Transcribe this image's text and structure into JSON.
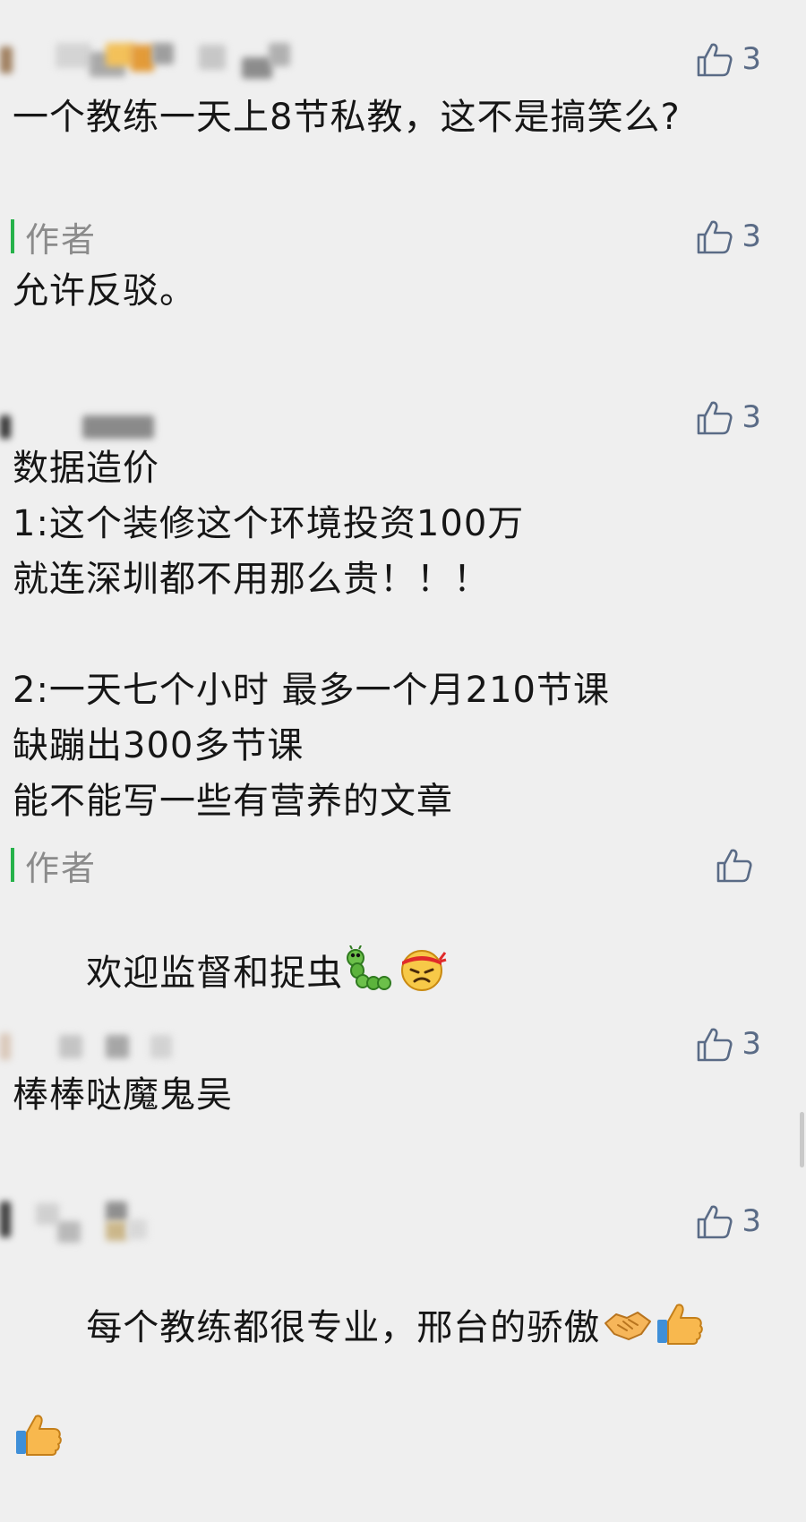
{
  "comments": [
    {
      "likes": "3",
      "text": "一个教练一天上8节私教，这不是搞笑么?",
      "reply": {
        "author_label": "作者",
        "likes": "3",
        "text": "允许反驳。"
      }
    },
    {
      "likes": "3",
      "text": "数据造价\n1:这个装修这个环境投资100万\n就连深圳都不用那么贵！！！\n\n2:一天七个小时 最多一个月210节课\n缺蹦出300多节课\n能不能写一些有营养的文章",
      "reply": {
        "author_label": "作者",
        "likes": "",
        "text": "欢迎监督和捉虫"
      }
    },
    {
      "likes": "3",
      "text": "棒棒哒魔鬼吴"
    },
    {
      "likes": "3",
      "text": "每个教练都很专业，邢台的骄傲"
    }
  ],
  "icons": {
    "like": "thumbs-up-outline-icon",
    "emoji_caterpillar": "caterpillar-emoji",
    "emoji_determined": "determined-face-emoji",
    "emoji_handshake": "handshake-emoji",
    "emoji_thumbs_up": "thumbs-up-emoji"
  },
  "colors": {
    "background": "#efefef",
    "like_icon": "#5a6b86",
    "author_bar": "#26b24a",
    "author_label": "#8b8b8b",
    "text": "#161616"
  }
}
